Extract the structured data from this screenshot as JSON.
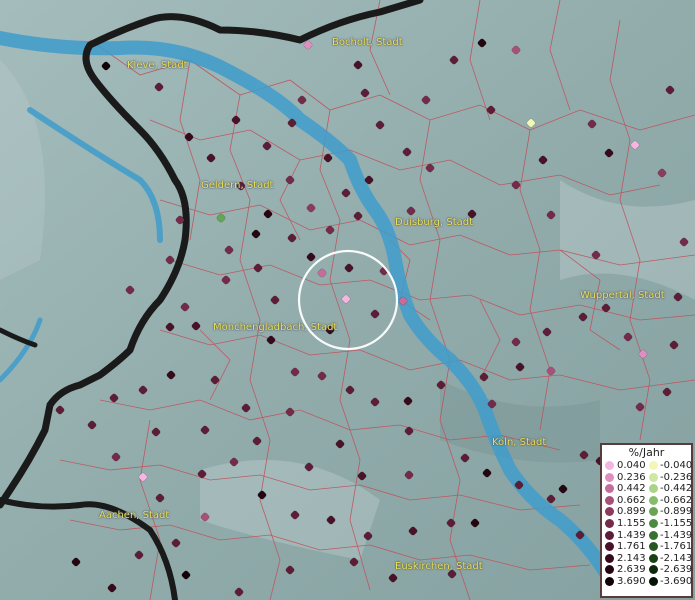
{
  "legend": {
    "title": "%/Jahr",
    "positive": [
      {
        "label": "0.040",
        "color": "#f2b6e0"
      },
      {
        "label": "0.236",
        "color": "#de8fbf"
      },
      {
        "label": "0.442",
        "color": "#c66c9b"
      },
      {
        "label": "0.662",
        "color": "#a8507a"
      },
      {
        "label": "0.899",
        "color": "#8c3a5f"
      },
      {
        "label": "1.155",
        "color": "#742a49"
      },
      {
        "label": "1.439",
        "color": "#5e1d37"
      },
      {
        "label": "1.761",
        "color": "#4a1228"
      },
      {
        "label": "2.143",
        "color": "#370a1b"
      },
      {
        "label": "2.639",
        "color": "#250510"
      },
      {
        "label": "3.690",
        "color": "#120207"
      }
    ],
    "negative": [
      {
        "label": "-0.040",
        "color": "#f4f6b8"
      },
      {
        "label": "-0.236",
        "color": "#cde8a0"
      },
      {
        "label": "-0.442",
        "color": "#a9d486"
      },
      {
        "label": "-0.662",
        "color": "#86bd6a"
      },
      {
        "label": "-0.899",
        "color": "#66a553"
      },
      {
        "label": "-1.155",
        "color": "#4b8b3f"
      },
      {
        "label": "-1.439",
        "color": "#37712f"
      },
      {
        "label": "-1.761",
        "color": "#275821"
      },
      {
        "label": "-2.143",
        "color": "#1a4016"
      },
      {
        "label": "-2.639",
        "color": "#0e2a0c"
      },
      {
        "label": "-3.690",
        "color": "#041404"
      }
    ]
  },
  "cities": [
    {
      "name": "Bocholt, Stadt"
    },
    {
      "name": "Kleve, Stadt"
    },
    {
      "name": "Geldern, Stadt"
    },
    {
      "name": "Duisburg, Stadt"
    },
    {
      "name": "Wuppertal, Stadt"
    },
    {
      "name": "Mönchengladbach, Stadt"
    },
    {
      "name": "Köln, Stadt"
    },
    {
      "name": "Aachen, Stadt"
    },
    {
      "name": "Euskirchen, Stadt"
    }
  ],
  "colors": {
    "background": "#93aeae",
    "river": "#3f9ccb",
    "border": "#1a1a1a",
    "district_lines": "#c0505a",
    "highlight_ring": "#ffffff"
  }
}
